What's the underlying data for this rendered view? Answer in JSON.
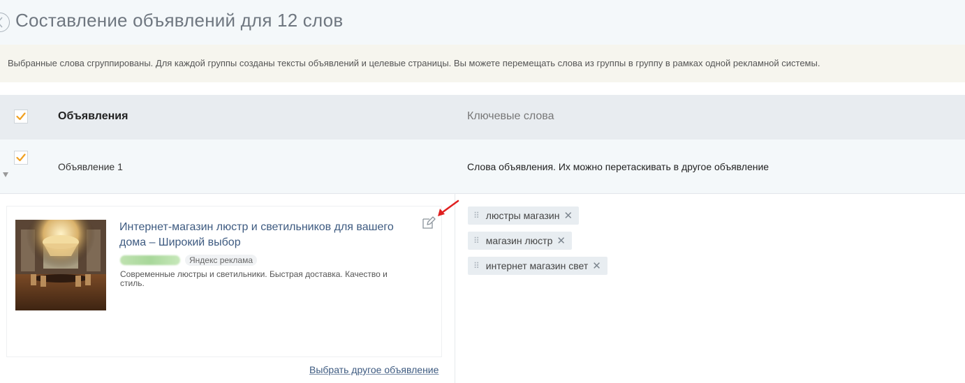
{
  "page": {
    "title": "Составление объявлений для 12 слов",
    "info": "Выбранные слова сгруппированы. Для каждой группы созданы тексты объявлений и целевые страницы. Вы можете перемещать слова из группы в группу в рамках одной рекламной системы."
  },
  "table": {
    "col_ads": "Объявления",
    "col_keywords": "Ключевые слова"
  },
  "ad_group": {
    "label": "Объявление 1",
    "keywords_hint": "Слова объявления. Их можно перетаскивать в другое объявление",
    "ad": {
      "title": "Интернет-магазин люстр и светильников для вашего дома – Широкий выбор",
      "badge": "Яндекс реклама",
      "text": "Современные люстры и светильники. Быстрая доставка. Качество и стиль."
    },
    "choose_link": "Выбрать другое объявление",
    "keywords": [
      "люстры магазин",
      "магазин люстр",
      "интернет магазин свет"
    ]
  },
  "colors": {
    "accent_check": "#f0a020",
    "link": "#3d5a80",
    "annotation_arrow": "#e02020"
  }
}
